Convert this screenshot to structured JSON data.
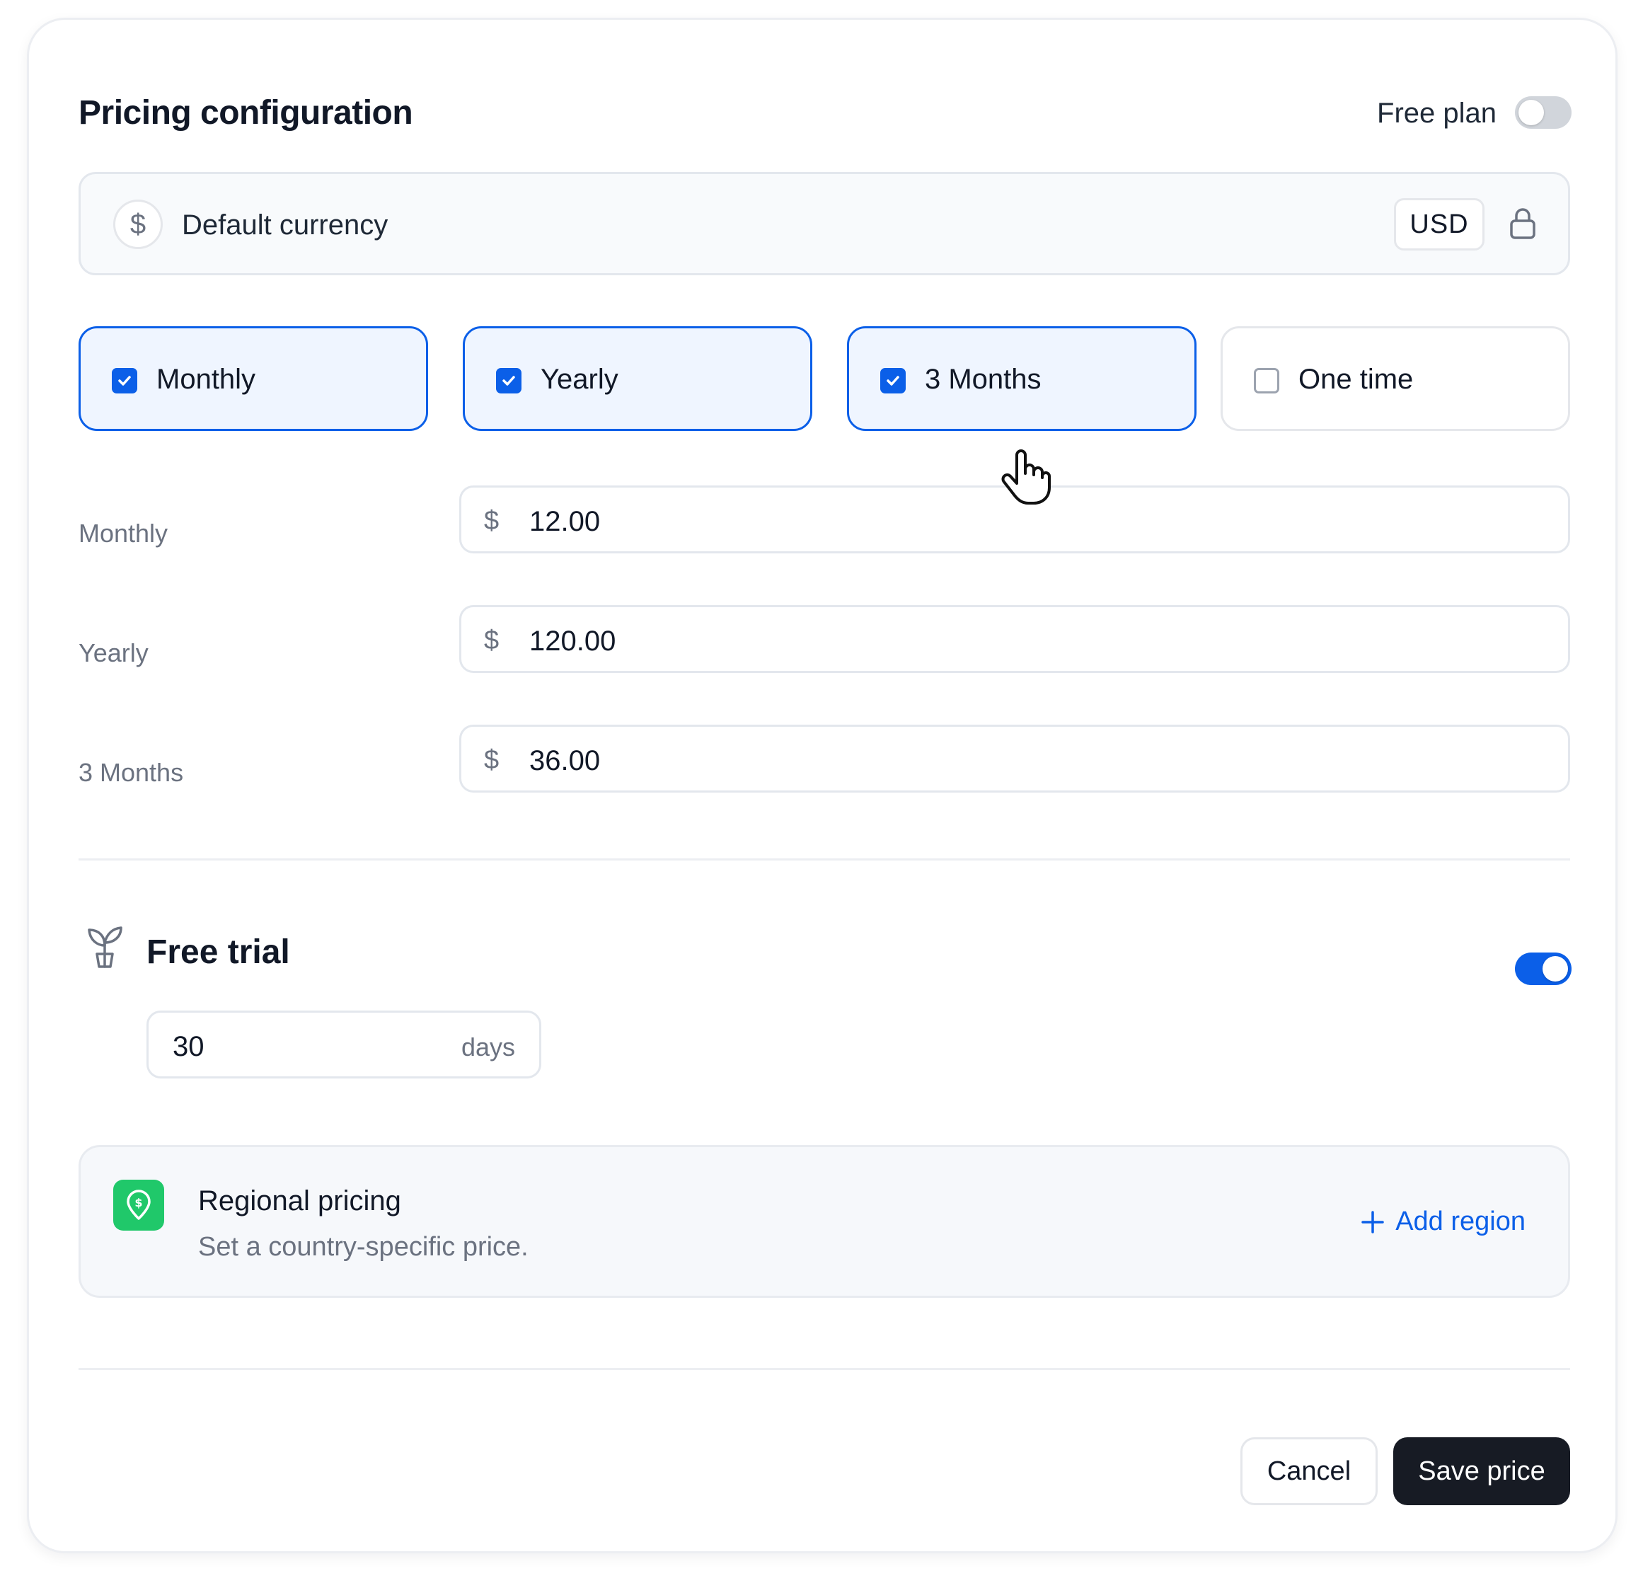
{
  "header": {
    "title": "Pricing configuration",
    "free_plan_label": "Free plan",
    "free_plan_enabled": false
  },
  "currency": {
    "symbol": "$",
    "label": "Default currency",
    "code": "USD",
    "icon": "lock-icon"
  },
  "billing_options": [
    {
      "label": "Monthly",
      "checked": true
    },
    {
      "label": "Yearly",
      "checked": true
    },
    {
      "label": "3 Months",
      "checked": true
    },
    {
      "label": "One time",
      "checked": false
    }
  ],
  "prices": [
    {
      "label": "Monthly",
      "currency_symbol": "$",
      "value": "12.00"
    },
    {
      "label": "Yearly",
      "currency_symbol": "$",
      "value": "120.00"
    },
    {
      "label": "3 Months",
      "currency_symbol": "$",
      "value": "36.00"
    }
  ],
  "free_trial": {
    "title": "Free trial",
    "enabled": true,
    "value": "30",
    "unit": "days",
    "icon": "sprout-icon"
  },
  "regional_pricing": {
    "title": "Regional pricing",
    "subtitle": "Set a country-specific price.",
    "add_label": "Add region",
    "icon": "map-pin-dollar-icon"
  },
  "footer": {
    "cancel_label": "Cancel",
    "save_label": "Save price"
  },
  "colors": {
    "accent": "#0b5fe8",
    "checked_bg": "#eff5ff",
    "region_icon_bg": "#20c86a",
    "primary_button": "#171b24"
  }
}
